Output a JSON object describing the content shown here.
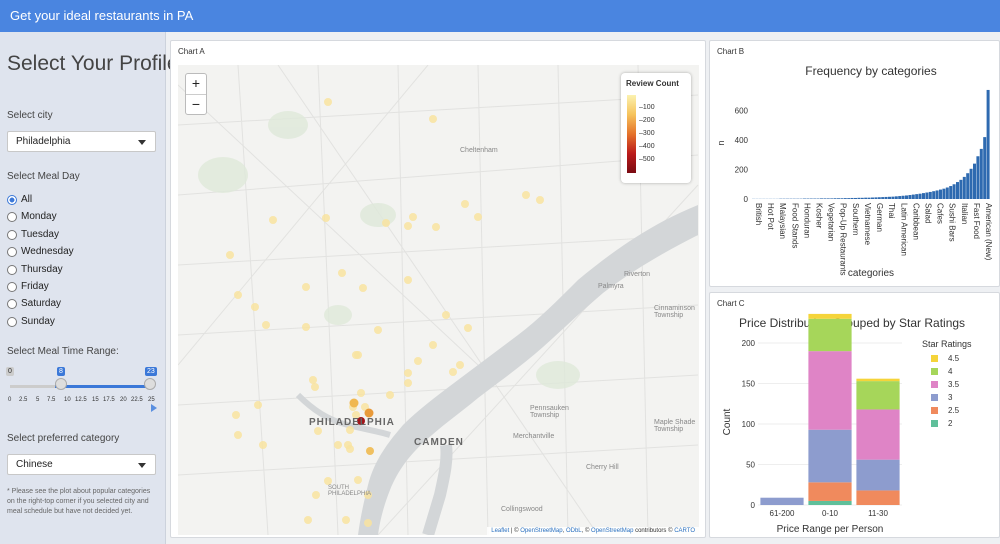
{
  "header": {
    "title": "Get your ideal restaurants in PA"
  },
  "sidebar": {
    "title": "Select Your Profile",
    "city_label": "Select city",
    "city_value": "Philadelphia",
    "meal_day_label": "Select Meal Day",
    "days": [
      "All",
      "Monday",
      "Tuesday",
      "Wednesday",
      "Thursday",
      "Friday",
      "Saturday",
      "Sunday"
    ],
    "selected_day": "All",
    "time_label": "Select Meal Time Range:",
    "time_min": "0",
    "time_from": "8",
    "time_to": "23",
    "time_ticks": [
      "0",
      "2.5",
      "5",
      "7.5",
      "10",
      "12.5",
      "15",
      "17.5",
      "20",
      "22.5",
      "25"
    ],
    "category_label": "Select preferred category",
    "category_value": "Chinese",
    "note": "* Please see the plot about popular categories on the right-top corner if you selected city and meal schedule but have not decided yet."
  },
  "chart_a": {
    "panel_title": "Chart A",
    "zoom_in": "+",
    "zoom_out": "−",
    "legend_title": "Review Count",
    "legend_labels": [
      "100",
      "200",
      "300",
      "400",
      "500"
    ],
    "place_labels": [
      "Cheltenham",
      "PHILADELPHIA",
      "CAMDEN",
      "Riverton",
      "Palmyra",
      "Cinnaminson Township",
      "Pennsauken Township",
      "Merchantville",
      "Maple Shade Township",
      "Cherry Hill",
      "Collingswood",
      "SOUTH PHILADELPHIA"
    ],
    "attribution": {
      "leaflet": "Leaflet",
      "osm": "OpenStreetMap",
      "odbl": "ODbL",
      "contributors": "contributors",
      "carto": "CARTO"
    },
    "colors": {
      "low": "#fbf2b0",
      "high": "#7a0b12"
    }
  },
  "chart_data": [
    {
      "type": "bar",
      "panel_title": "Chart B",
      "title": "Frequency by categories",
      "xlabel": "categories",
      "ylabel": "n",
      "ylim": [
        0,
        760
      ],
      "yticks": [
        0,
        200,
        400,
        600
      ],
      "tick_labels": [
        "British",
        "Hot Pot",
        "Malaysian",
        "Food Stands",
        "Honduran",
        "Kosher",
        "Vegetarian",
        "Pop-Up Restaurants",
        "Southern",
        "Vietnamese",
        "German",
        "Thai",
        "Latin American",
        "Caribbean",
        "Salad",
        "Cafes",
        "Sushi Bars",
        "Italian",
        "Fast Food",
        "American (New)"
      ],
      "values": [
        1,
        1,
        1,
        1,
        1,
        1,
        1,
        1,
        2,
        2,
        2,
        2,
        2,
        2,
        2,
        3,
        3,
        3,
        3,
        3,
        4,
        4,
        4,
        4,
        5,
        5,
        5,
        6,
        6,
        7,
        7,
        8,
        8,
        9,
        9,
        10,
        11,
        12,
        13,
        14,
        15,
        16,
        18,
        20,
        22,
        24,
        27,
        30,
        33,
        36,
        40,
        44,
        48,
        53,
        58,
        64,
        70,
        78,
        88,
        100,
        115,
        130,
        150,
        175,
        205,
        240,
        290,
        340,
        420,
        740
      ],
      "color": "#2e6ab0"
    },
    {
      "type": "bar",
      "panel_title": "Chart C",
      "title": "Price Distribution Grouped by Star Ratings",
      "xlabel": "Price Range per Person",
      "ylabel": "Count",
      "legend_title": "Star Ratings",
      "legend_position": "top-right",
      "ylim": [
        0,
        205
      ],
      "yticks": [
        0,
        50,
        100,
        150,
        200
      ],
      "categories": [
        "61-200",
        "0-10",
        "11-30"
      ],
      "series": [
        {
          "name": "2",
          "color": "#5fbf9a",
          "values": [
            0,
            5,
            0
          ]
        },
        {
          "name": "2.5",
          "color": "#f08a5d",
          "values": [
            0,
            23,
            18
          ]
        },
        {
          "name": "3",
          "color": "#8d9cce",
          "values": [
            9,
            65,
            38
          ]
        },
        {
          "name": "3.5",
          "color": "#df84c6",
          "values": [
            0,
            97,
            62
          ]
        },
        {
          "name": "4",
          "color": "#a6d65a",
          "values": [
            0,
            40,
            35
          ]
        },
        {
          "name": "4.5",
          "color": "#f5d43a",
          "values": [
            0,
            6,
            3
          ]
        }
      ]
    }
  ]
}
